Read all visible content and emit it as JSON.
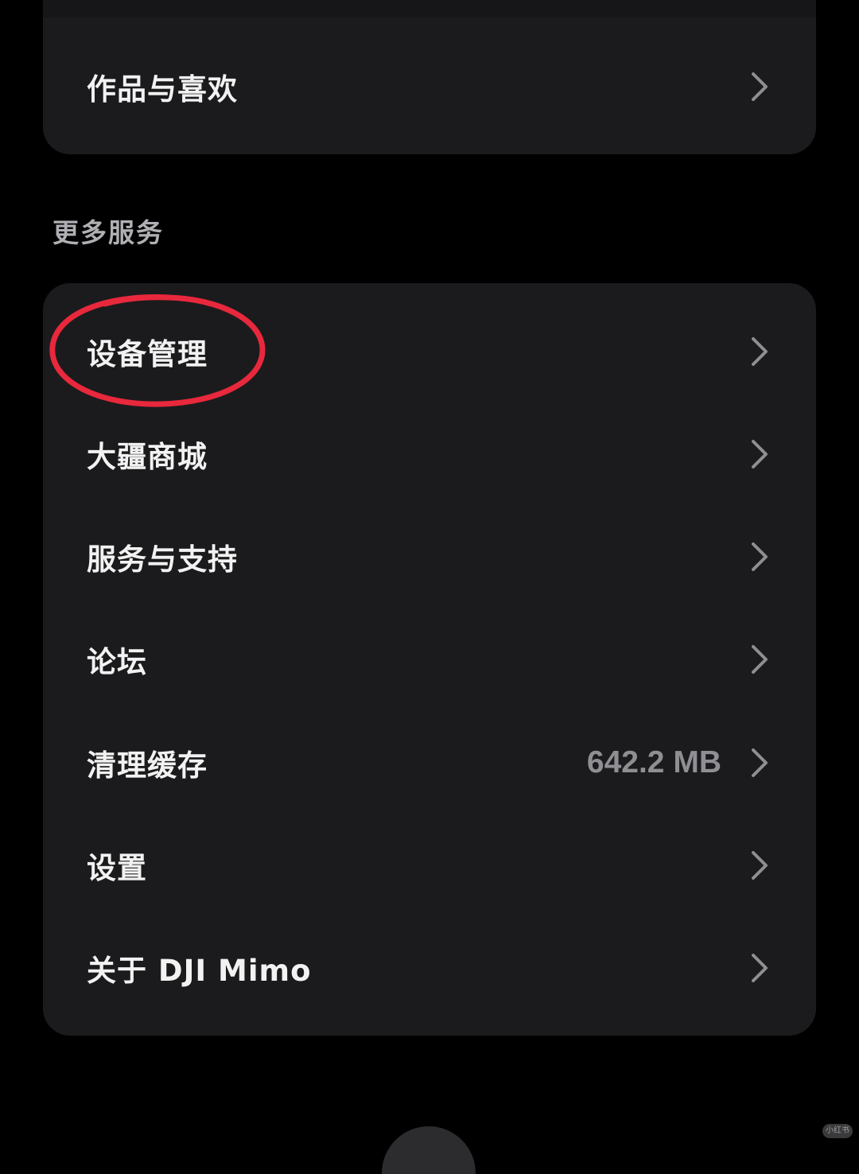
{
  "top_card": {
    "item": {
      "label": "作品与喜欢",
      "icon": "chevron-right-icon"
    }
  },
  "section": {
    "title": "更多服务"
  },
  "menu": {
    "items": [
      {
        "label": "设备管理",
        "value": "",
        "icon": "chevron-right-icon",
        "highlighted": true
      },
      {
        "label": "大疆商城",
        "value": "",
        "icon": "chevron-right-icon"
      },
      {
        "label": "服务与支持",
        "value": "",
        "icon": "chevron-right-icon"
      },
      {
        "label": "论坛",
        "value": "",
        "icon": "chevron-right-icon"
      },
      {
        "label": "清理缓存",
        "value": "642.2 MB",
        "icon": "chevron-right-icon"
      },
      {
        "label": "设置",
        "value": "",
        "icon": "chevron-right-icon"
      },
      {
        "label": "关于 DJI Mimo",
        "value": "",
        "icon": "chevron-right-icon"
      }
    ]
  },
  "annotation": {
    "type": "hand-drawn-circle",
    "color": "#e8283c",
    "target": "设备管理"
  },
  "watermark": {
    "text": "小红书"
  },
  "colors": {
    "background": "#000000",
    "card": "#1b1b1d",
    "label": "#f2f2f2",
    "secondary": "#8e8e93",
    "chevron": "#8e8e93"
  }
}
